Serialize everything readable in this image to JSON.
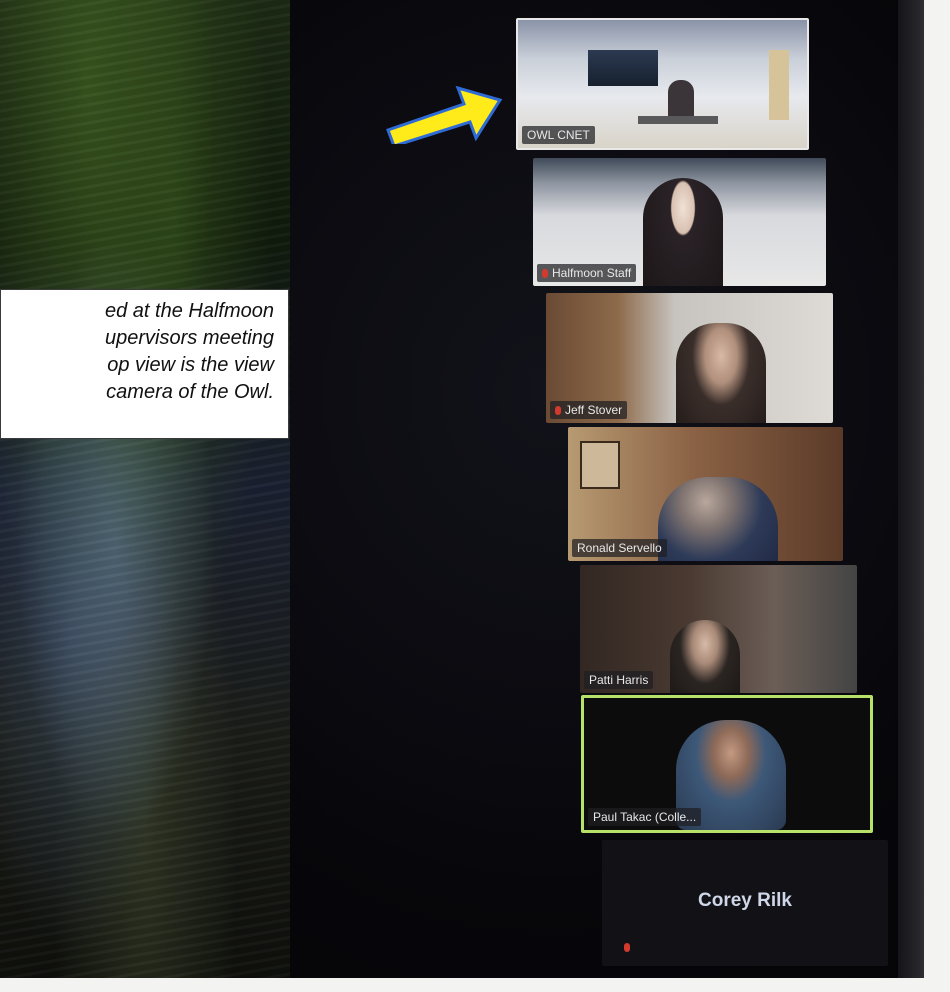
{
  "caption": {
    "text": "ed at the Halfmoon\nupervisors meeting\nop view is the view\ncamera of the Owl."
  },
  "arrow": {
    "color": "#ffeb1a",
    "icon": "arrow-right-icon"
  },
  "gallery": {
    "tiles": [
      {
        "name": "OWL CNET",
        "muted": false
      },
      {
        "name": "Halfmoon Staff",
        "muted": true
      },
      {
        "name": "Jeff Stover",
        "muted": true
      },
      {
        "name": "Ronald Servello",
        "muted": false
      },
      {
        "name": "Patti Harris",
        "muted": false
      },
      {
        "name": "Paul Takac (Colle...",
        "muted": false,
        "active_speaker": true
      },
      {
        "name": "Corey Rilk",
        "muted": true,
        "video_off": true
      }
    ],
    "active_border_color": "#b7e26a"
  }
}
